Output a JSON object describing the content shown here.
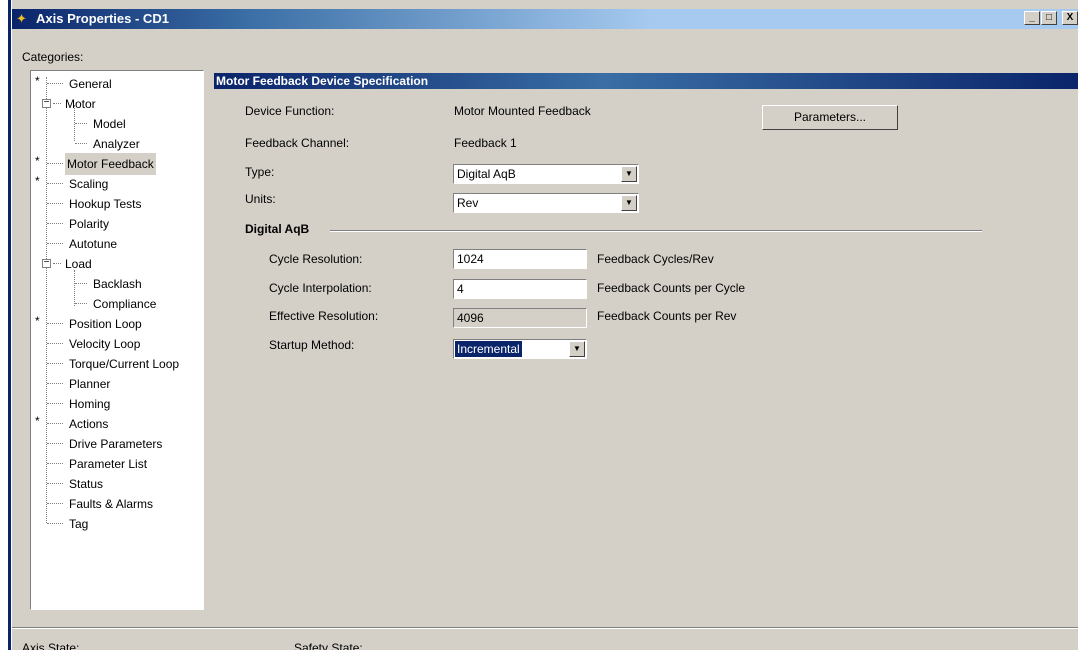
{
  "window": {
    "title": "Axis Properties - CD1",
    "minimize_glyph": "_",
    "maximize_glyph": "□",
    "close_glyph": "X"
  },
  "categories": {
    "label": "Categories:",
    "items": [
      {
        "label": "General",
        "star": true
      },
      {
        "label": "Motor",
        "expanded": true
      },
      {
        "label": "Model"
      },
      {
        "label": "Analyzer"
      },
      {
        "label": "Motor Feedback",
        "star": true,
        "selected": true
      },
      {
        "label": "Scaling",
        "star": true
      },
      {
        "label": "Hookup Tests"
      },
      {
        "label": "Polarity"
      },
      {
        "label": "Autotune"
      },
      {
        "label": "Load",
        "expanded": true
      },
      {
        "label": "Backlash"
      },
      {
        "label": "Compliance"
      },
      {
        "label": "Position Loop",
        "star": true
      },
      {
        "label": "Velocity Loop"
      },
      {
        "label": "Torque/Current Loop"
      },
      {
        "label": "Planner"
      },
      {
        "label": "Homing"
      },
      {
        "label": "Actions",
        "star": true
      },
      {
        "label": "Drive Parameters"
      },
      {
        "label": "Parameter List"
      },
      {
        "label": "Status"
      },
      {
        "label": "Faults & Alarms"
      },
      {
        "label": "Tag"
      }
    ],
    "star_glyph": "*",
    "expander_glyph": "−"
  },
  "panel": {
    "header": "Motor Feedback Device Specification",
    "device_function_label": "Device Function:",
    "device_function_value": "Motor Mounted Feedback",
    "parameters_button": "Parameters...",
    "feedback_channel_label": "Feedback Channel:",
    "feedback_channel_value": "Feedback 1",
    "type_label": "Type:",
    "type_value": "Digital AqB",
    "units_label": "Units:",
    "units_value": "Rev",
    "group_title": "Digital AqB",
    "cycle_resolution_label": "Cycle Resolution:",
    "cycle_resolution_value": "1024",
    "cycle_resolution_unit": "Feedback Cycles/Rev",
    "cycle_interpolation_label": "Cycle Interpolation:",
    "cycle_interpolation_value": "4",
    "cycle_interpolation_unit": "Feedback Counts per Cycle",
    "effective_resolution_label": "Effective Resolution:",
    "effective_resolution_value": "4096",
    "effective_resolution_unit": "Feedback Counts per Rev",
    "startup_method_label": "Startup Method:",
    "startup_method_value": "Incremental",
    "dropdown_arrow": "▼"
  },
  "status_bar": {
    "axis_state_label": "Axis State:",
    "safety_state_label": "Safety State:"
  },
  "colors": {
    "title_gradient_start": "#0a246a",
    "title_gradient_end": "#a6caf0",
    "face": "#d4d0c8",
    "selection": "#0a246a"
  }
}
